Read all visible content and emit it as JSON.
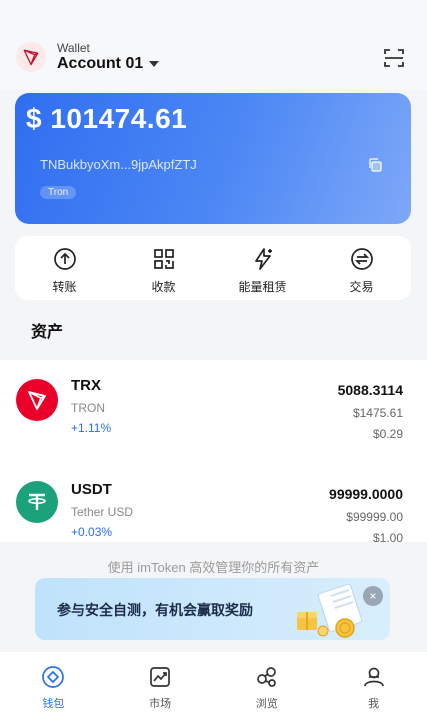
{
  "header": {
    "wallet_subtitle": "Wallet",
    "account_name": "Account 01"
  },
  "balance_card": {
    "amount": "$ 101474.61",
    "address": "TNBukbyoXm...9jpAkpfZTJ",
    "chain": "Tron"
  },
  "actions": [
    {
      "label": "转账",
      "icon": "transfer-icon"
    },
    {
      "label": "收款",
      "icon": "receive-qr-icon"
    },
    {
      "label": "能量租赁",
      "icon": "energy-icon"
    },
    {
      "label": "交易",
      "icon": "swap-icon"
    }
  ],
  "assets_title": "资产",
  "assets": [
    {
      "symbol": "TRX",
      "name": "TRON",
      "change": "+1.11%",
      "amount": "5088.3114",
      "value": "$1475.61",
      "price": "$0.29",
      "icon": "tron-icon",
      "color": "#eb0029"
    },
    {
      "symbol": "USDT",
      "name": "Tether USD",
      "change": "+0.03%",
      "amount": "99999.0000",
      "value": "$99999.00",
      "price": "$1.00",
      "icon": "tether-icon",
      "color": "#1ba27a"
    }
  ],
  "promo_text": "使用 imToken 高效管理你的所有资产",
  "banner": {
    "text": "参与安全自测，有机会赢取奖励",
    "close": "×"
  },
  "nav": [
    {
      "label": "钱包",
      "icon": "wallet-icon",
      "active": true
    },
    {
      "label": "市场",
      "icon": "market-chart-icon",
      "active": false
    },
    {
      "label": "浏览",
      "icon": "browse-icon",
      "active": false
    },
    {
      "label": "我",
      "icon": "profile-icon",
      "active": false
    }
  ],
  "colors": {
    "accent": "#2a6df4",
    "card_gradient_start": "#2f6ef0",
    "card_gradient_end": "#7ea8f8",
    "tron_red": "#eb0029",
    "tether_green": "#1ba27a"
  }
}
